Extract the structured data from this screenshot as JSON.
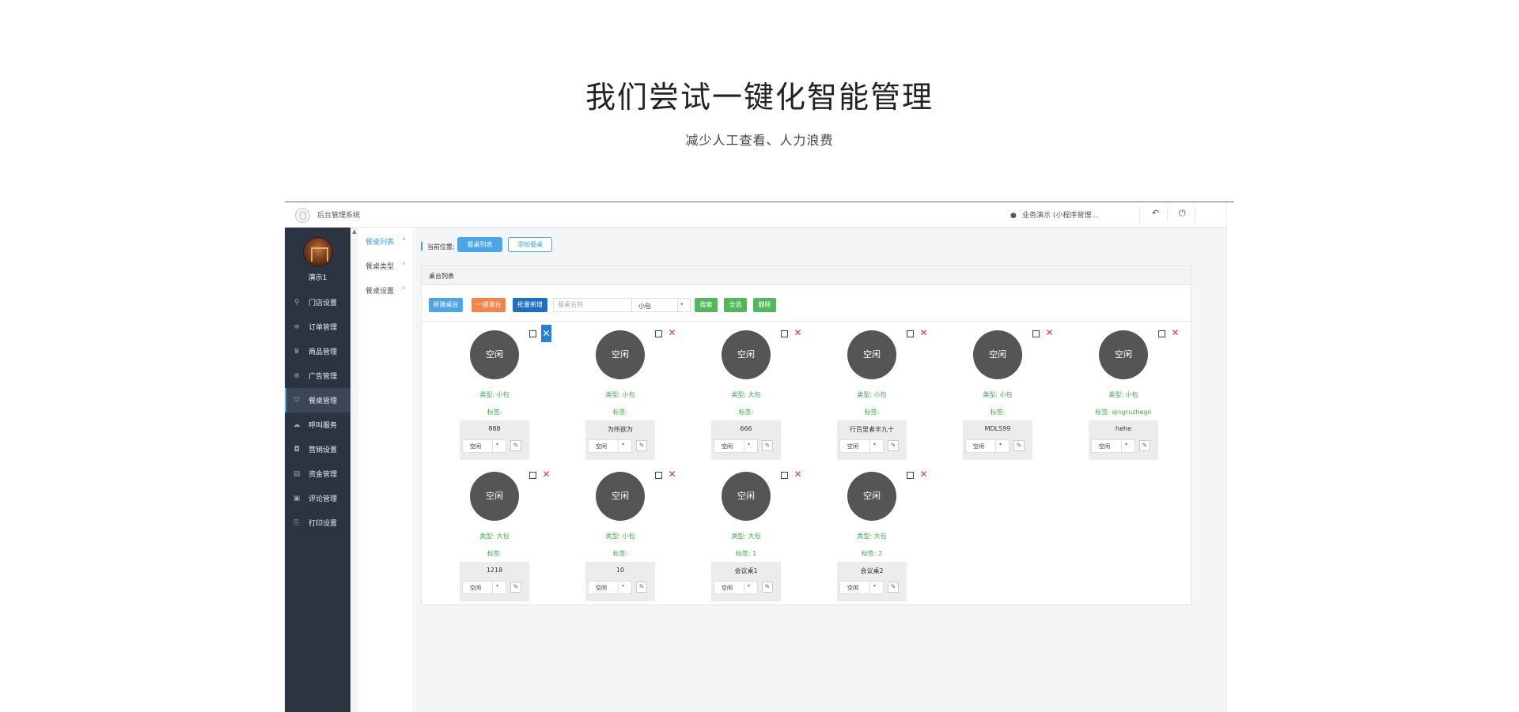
{
  "hero": {
    "title": "我们尝试一键化智能管理",
    "subtitle": "减少人工查看、人力浪费"
  },
  "topbar": {
    "system_title": "后台管理系统",
    "user_label": "业务演示 (小程序管理...",
    "back_icon": "↶",
    "power_icon": "⏻"
  },
  "sidebar": {
    "username": "演示1",
    "items": [
      {
        "label": "门店设置",
        "icon": "⚲",
        "icon_name": "key-icon"
      },
      {
        "label": "订单管理",
        "icon": "≡",
        "icon_name": "list-icon"
      },
      {
        "label": "商品管理",
        "icon": "♛",
        "icon_name": "trophy-icon"
      },
      {
        "label": "广告管理",
        "icon": "⊕",
        "icon_name": "target-icon"
      },
      {
        "label": "餐桌管理",
        "icon": "⛫",
        "icon_name": "binoculars-icon",
        "active": true
      },
      {
        "label": "呼叫服务",
        "icon": "☁",
        "icon_name": "cloud-icon"
      },
      {
        "label": "营销设置",
        "icon": "◘",
        "icon_name": "gift-icon"
      },
      {
        "label": "资金管理",
        "icon": "▤",
        "icon_name": "book-icon"
      },
      {
        "label": "评论管理",
        "icon": "▣",
        "icon_name": "money-icon"
      },
      {
        "label": "打印设置",
        "icon": "⎘",
        "icon_name": "copy-icon"
      }
    ]
  },
  "subnav": {
    "items": [
      {
        "label": "餐桌列表",
        "arrow": "›",
        "active": true
      },
      {
        "label": "餐桌类型",
        "arrow": "›"
      },
      {
        "label": "餐桌设置",
        "arrow": "›"
      }
    ]
  },
  "breadcrumb": {
    "label": "当前位置:",
    "current": "餐桌列表",
    "add": "添加餐桌"
  },
  "panel": {
    "title": "桌台列表"
  },
  "toolbar": {
    "new_table": "新建桌台",
    "one_click_clear": "一键清台",
    "batch_add": "批量新增",
    "search_placeholder": "餐桌名称",
    "type_select": "小包",
    "search": "搜索",
    "select_all": "全选",
    "delete": "删除",
    "colors": {
      "blue": "#4aa6e8",
      "orange": "#f5844a",
      "darkblue": "#1f6fc4",
      "green": "#52b85c"
    }
  },
  "card_labels": {
    "status": "空闲",
    "type_prefix": "类型: ",
    "tag_prefix": "标签: ",
    "dropdown_value": "空闲",
    "delete_icon": "✕",
    "edit_icon": "✎",
    "chevron": "▾"
  },
  "tables": [
    {
      "type": "小包",
      "tag": "",
      "name": "888",
      "selected": true
    },
    {
      "type": "小包",
      "tag": "",
      "name": "为所欲为"
    },
    {
      "type": "大包",
      "tag": "",
      "name": "666"
    },
    {
      "type": "小包",
      "tag": "",
      "name": "行百里者半九十"
    },
    {
      "type": "小包",
      "tag": "",
      "name": "MDLS99"
    },
    {
      "type": "小包",
      "tag": "qingruzhegn",
      "name": "hehe"
    },
    {
      "type": "大包",
      "tag": "",
      "name": "1218"
    },
    {
      "type": "小包",
      "tag": "",
      "name": "10"
    },
    {
      "type": "大包",
      "tag": "1",
      "name": "会议桌1"
    },
    {
      "type": "大包",
      "tag": "2",
      "name": "会议桌2"
    }
  ]
}
